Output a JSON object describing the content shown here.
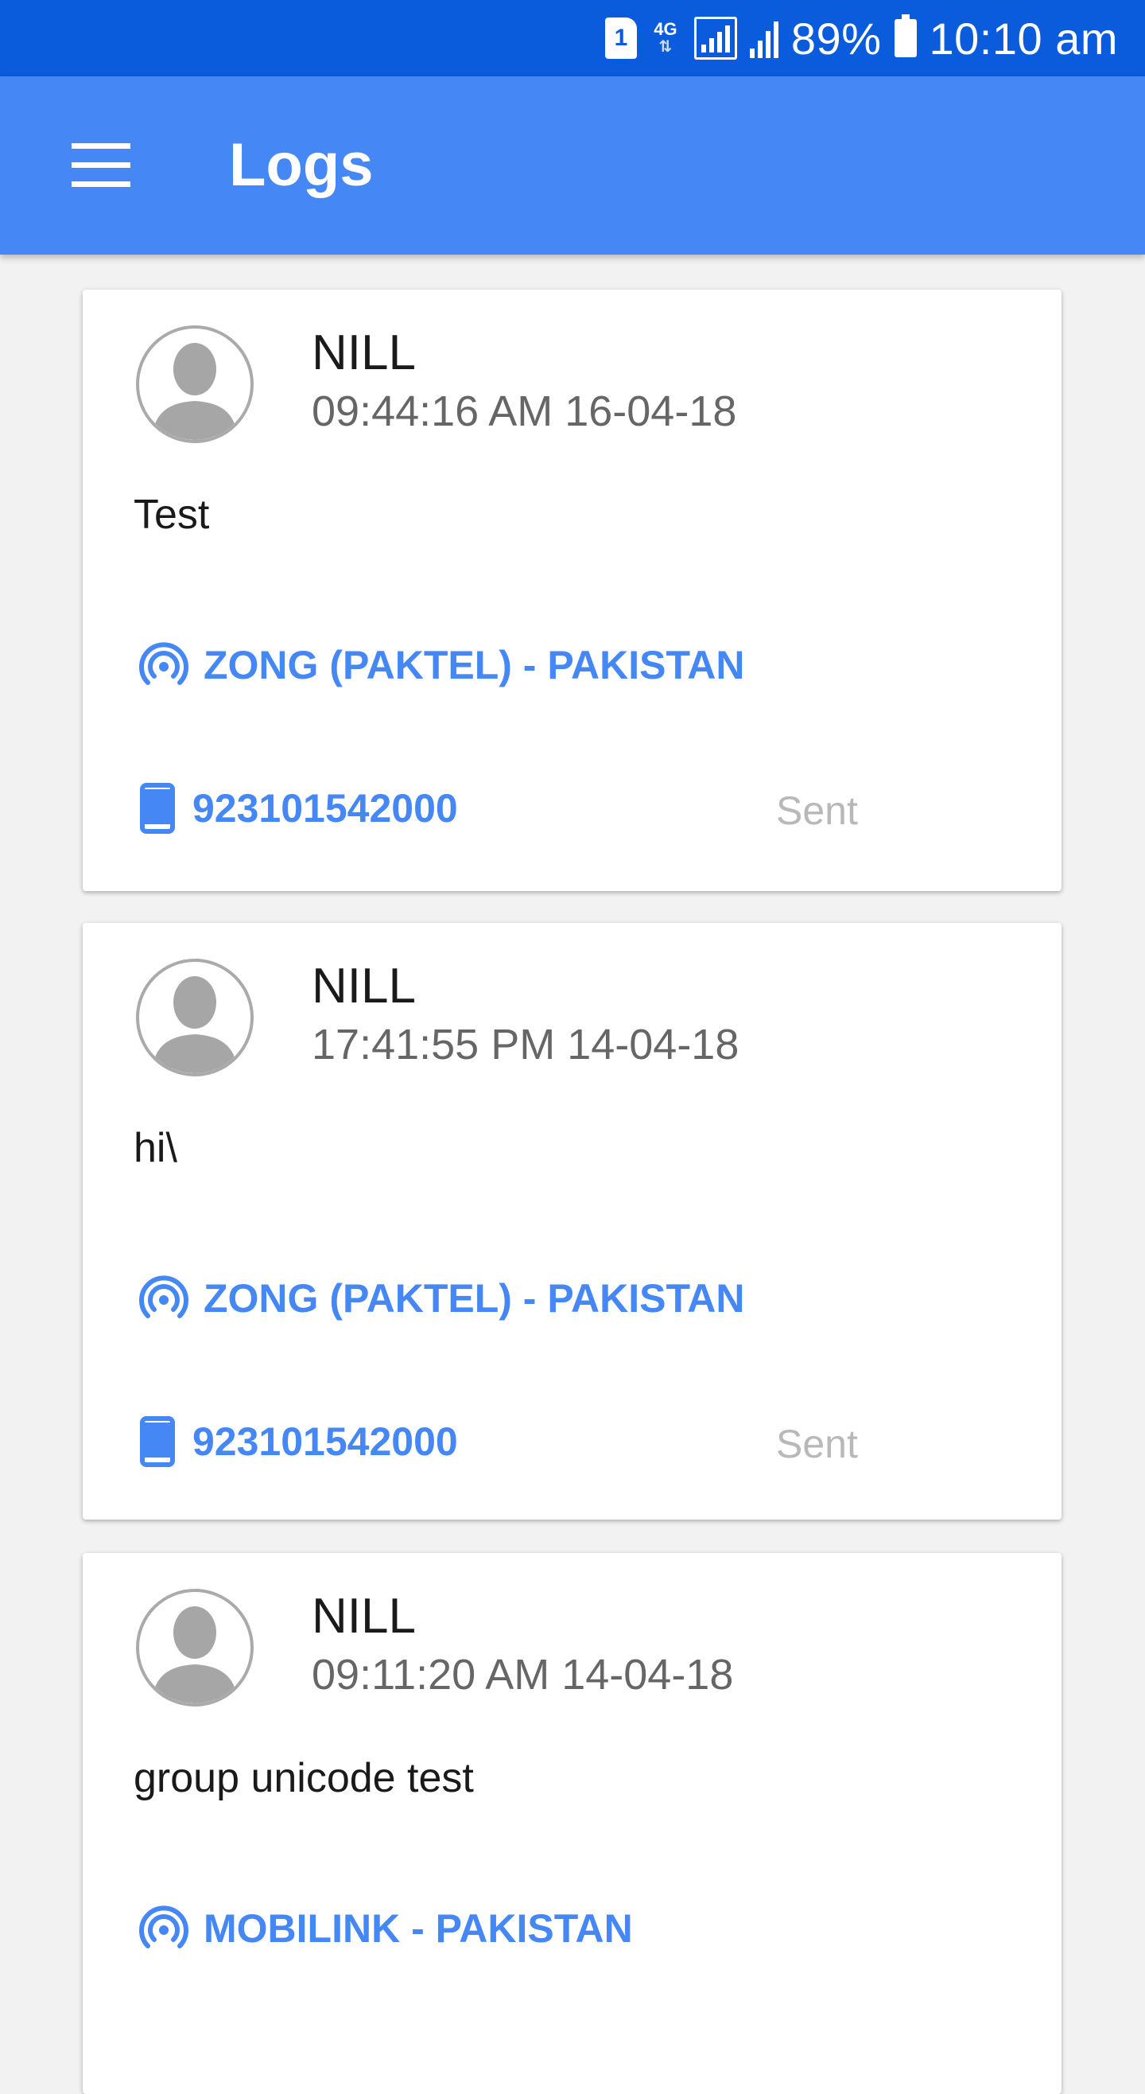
{
  "status_bar": {
    "sim_label": "1",
    "network_type": "4G",
    "battery_percent": "89%",
    "time": "10:10 am"
  },
  "app_bar": {
    "title": "Logs",
    "menu_icon": "hamburger-menu-icon"
  },
  "logs": [
    {
      "sender": "NILL",
      "time": "09:44:16 AM 16-04-18",
      "message": "Test",
      "operator": "ZONG (PAKTEL) - PAKISTAN",
      "phone": "923101542000",
      "status": "Sent"
    },
    {
      "sender": "NILL",
      "time": "17:41:55 PM 14-04-18",
      "message": "hi\\",
      "operator": "ZONG (PAKTEL) - PAKISTAN",
      "phone": "923101542000",
      "status": "Sent"
    },
    {
      "sender": "NILL",
      "time": "09:11:20 AM 14-04-18",
      "message": "group unicode test",
      "operator": "MOBILINK - PAKISTAN",
      "phone": "",
      "status": ""
    }
  ],
  "colors": {
    "status_bar": "#0b5cdc",
    "app_bar": "#4487f5",
    "accent": "#4487f5",
    "status_text": "#b8b8b8"
  }
}
